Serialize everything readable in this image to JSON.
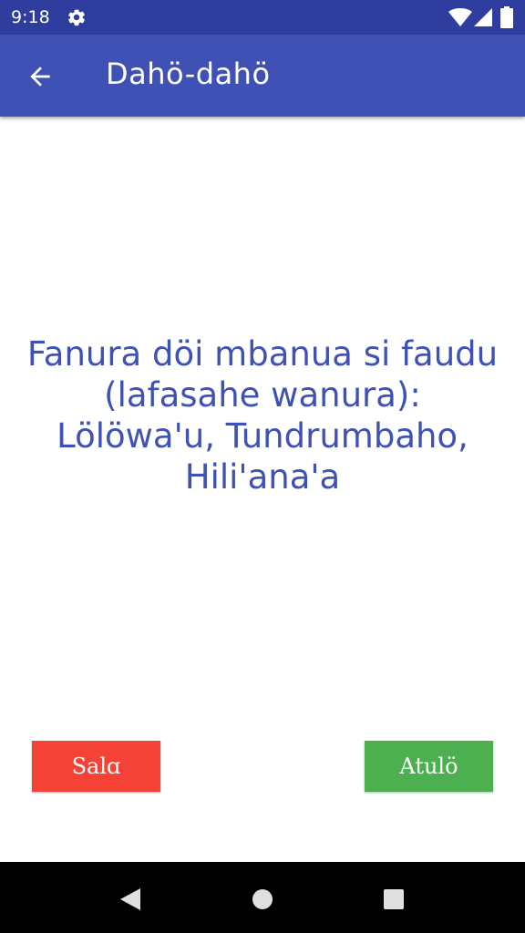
{
  "status_bar": {
    "time": "9:18",
    "icons": [
      "gear-icon",
      "wifi-icon",
      "cell-signal-icon",
      "battery-icon"
    ]
  },
  "app_bar": {
    "title": "Dahö-dahö",
    "back_icon": "arrow-back-icon"
  },
  "question": {
    "text": "Fanura döi mbanua si faudu (lafasahe wanura): Lölöwa'u, Tundrumbaho, Hili'ana'a"
  },
  "buttons": {
    "false_label": "Salɑ",
    "true_label": "Atulö"
  },
  "colors": {
    "status_bar": "#2f3e9e",
    "app_bar": "#3f51b5",
    "question_text": "#3f51b5",
    "false_button": "#f44336",
    "true_button": "#4caf50"
  },
  "nav_bar": {
    "icons": [
      "nav-back-icon",
      "nav-home-icon",
      "nav-recents-icon"
    ]
  }
}
